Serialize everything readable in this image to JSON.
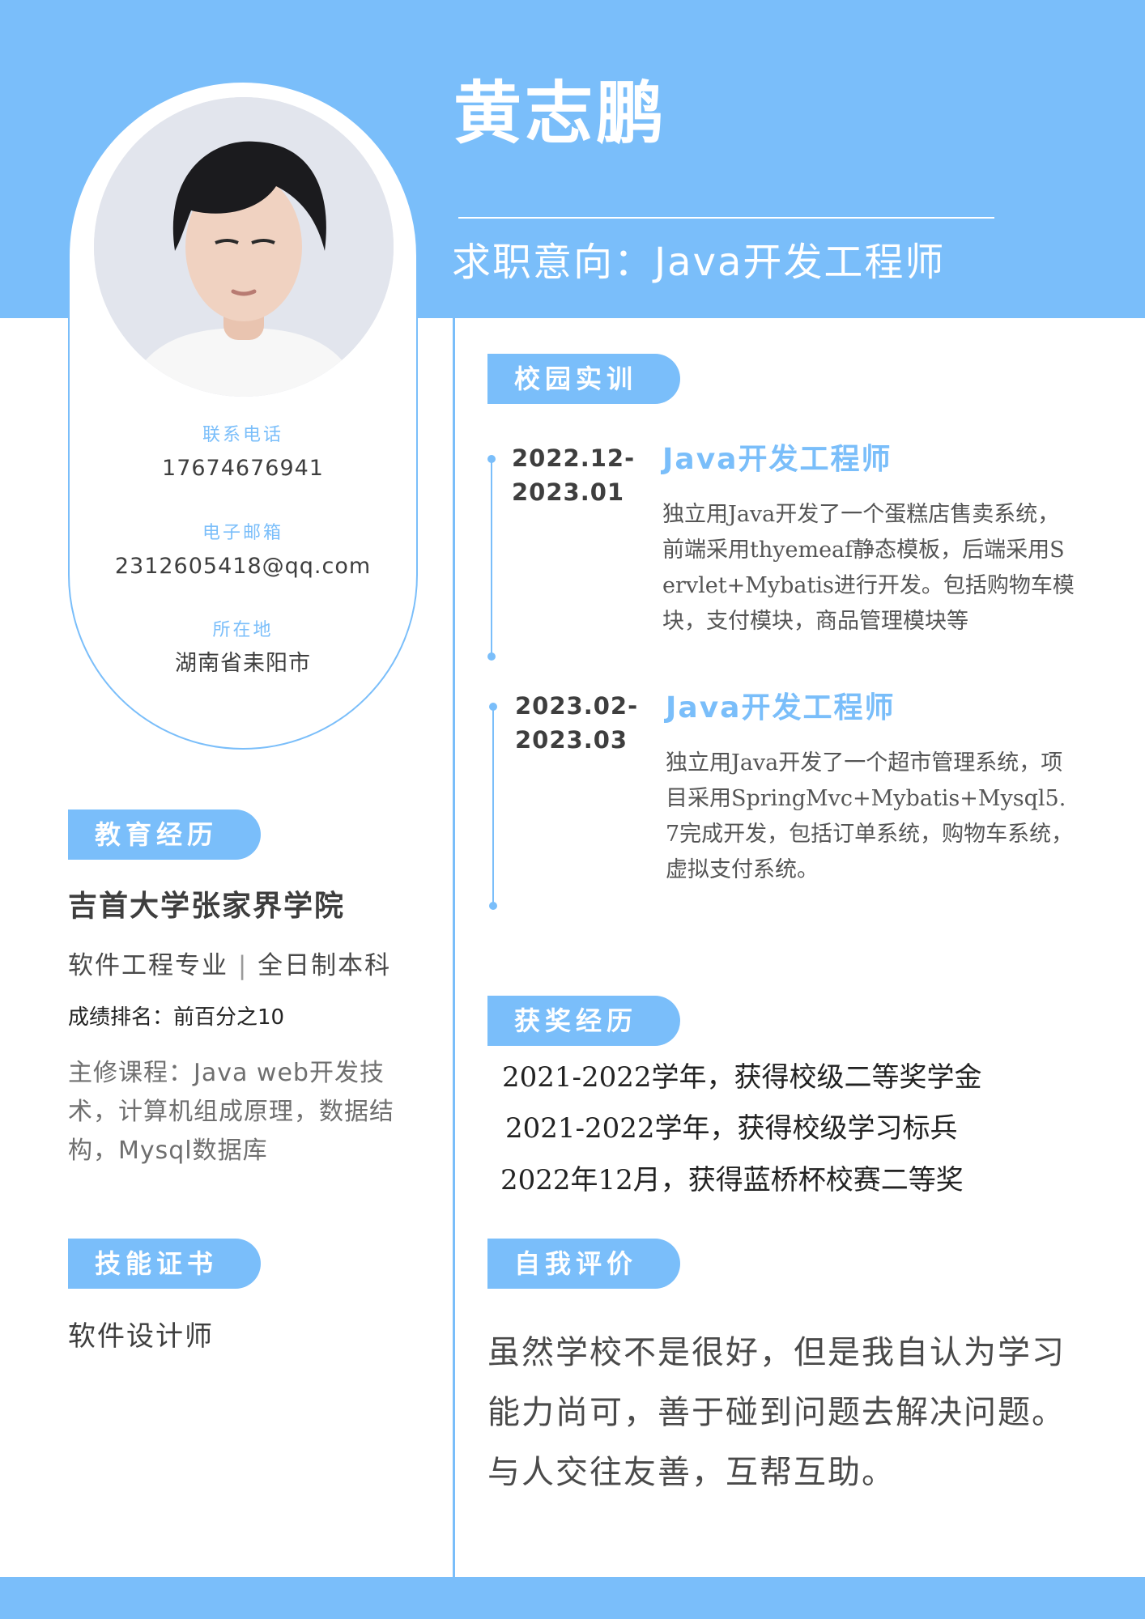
{
  "header": {
    "name": "黄志鹏",
    "job_intent": "求职意向：Java开发工程师"
  },
  "contact": {
    "phone_label": "联系电话",
    "phone": "17674676941",
    "email_label": "电子邮箱",
    "email": "2312605418@qq.com",
    "location_label": "所在地",
    "location": "湖南省耒阳市"
  },
  "education": {
    "section_title": "教育经历",
    "school": "吉首大学张家界学院",
    "major": "软件工程专业",
    "separator": "|",
    "degree": "全日制本科",
    "ranking": "成绩排名：前百分之10",
    "courses": "主修课程：Java web开发技术，计算机组成原理，数据结构，Mysql数据库"
  },
  "skills": {
    "section_title": "技能证书",
    "items": [
      "软件设计师"
    ]
  },
  "campus": {
    "section_title": "校园实训",
    "items": [
      {
        "date_start": "2022.12-",
        "date_end": "2023.01",
        "title": "Java开发工程师",
        "desc": "独立用Java开发了一个蛋糕店售卖系统，前端采用thyemeaf静态模板，后端采用Servlet+Mybatis进行开发。包括购物车模块，支付模块，商品管理模块等"
      },
      {
        "date_start": "2023.02-",
        "date_end": "2023.03",
        "title": "Java开发工程师",
        "desc": "独立用Java开发了一个超市管理系统，项目采用SpringMvc+Mybatis+Mysql5.7完成开发，包括订单系统，购物车系统，虚拟支付系统。"
      }
    ]
  },
  "awards": {
    "section_title": "获奖经历",
    "items": [
      "2021-2022学年，获得校级二等奖学金",
      "2021-2022学年，获得校级学习标兵",
      "2022年12月，获得蓝桥杯校赛二等奖"
    ]
  },
  "self_evaluation": {
    "section_title": "自我评价",
    "text": "虽然学校不是很好，但是我自认为学习能力尚可，善于碰到问题去解决问题。与人交往友善，互帮互助。"
  },
  "colors": {
    "accent": "#7abefa",
    "text_dark": "#3e3e3e",
    "text_muted": "#6f6f6f"
  }
}
